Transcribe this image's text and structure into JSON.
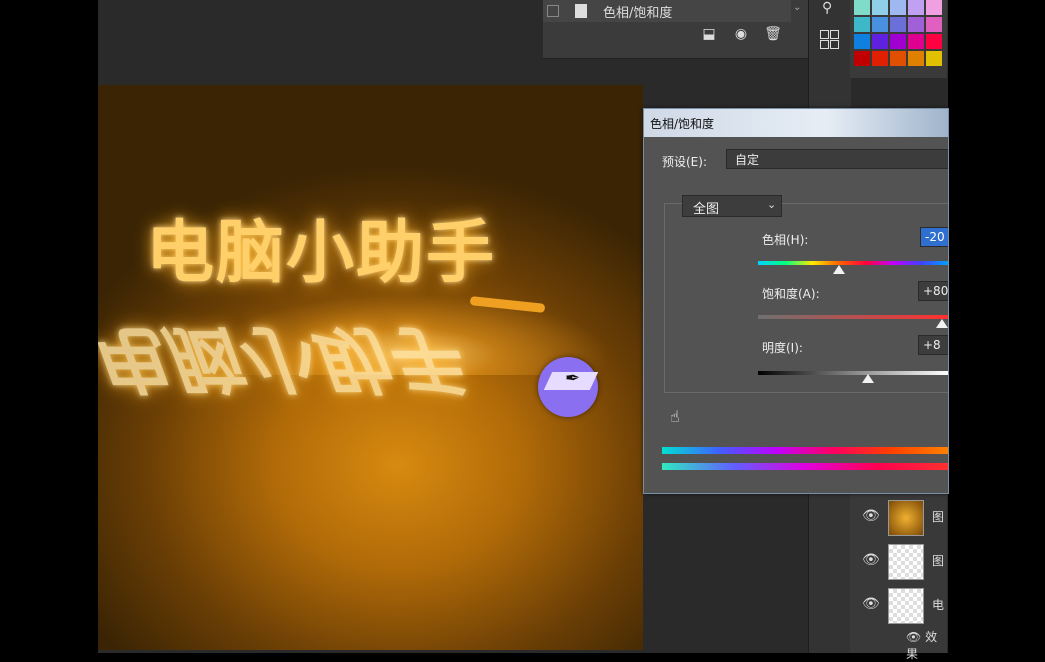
{
  "layers_panel_top": {
    "layer_label": "色相/饱和度",
    "icons": [
      "link-mask-icon",
      "camera-icon",
      "trash-icon"
    ]
  },
  "canvas": {
    "title_text": "电脑小助手",
    "reflection_text": "电脑小助手"
  },
  "dialog": {
    "title": "色相/饱和度",
    "preset_label": "预设(E):",
    "preset_value": "自定",
    "channel_value": "全图",
    "hue_label": "色相(H):",
    "hue_value": "-20",
    "saturation_label": "饱和度(A):",
    "saturation_value": "+80",
    "lightness_label": "明度(I):",
    "lightness_value": "+8"
  },
  "layers_list": {
    "rows": [
      {
        "name": "图"
      },
      {
        "name": "图"
      },
      {
        "name": "电"
      }
    ],
    "effects_label": "效果"
  },
  "colors": {
    "accent": "#2f6fd0",
    "cursor": "#8a6ff0"
  }
}
